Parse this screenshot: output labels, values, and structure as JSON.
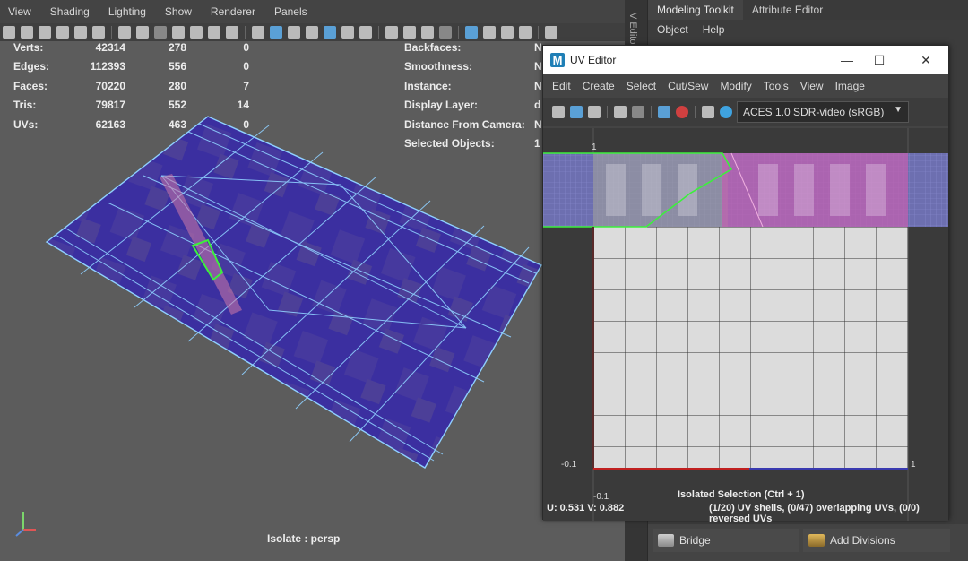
{
  "viewport": {
    "menu": [
      "View",
      "Shading",
      "Lighting",
      "Show",
      "Renderer",
      "Panels"
    ],
    "stats_left": [
      {
        "label": "Verts:",
        "a": "42314",
        "b": "278",
        "c": "0"
      },
      {
        "label": "Edges:",
        "a": "112393",
        "b": "556",
        "c": "0"
      },
      {
        "label": "Faces:",
        "a": "70220",
        "b": "280",
        "c": "7"
      },
      {
        "label": "Tris:",
        "a": "79817",
        "b": "552",
        "c": "14"
      },
      {
        "label": "UVs:",
        "a": "62163",
        "b": "463",
        "c": "0"
      }
    ],
    "stats_right": [
      {
        "label": "Backfaces:",
        "value": "N"
      },
      {
        "label": "Smoothness:",
        "value": "N"
      },
      {
        "label": "Instance:",
        "value": "N"
      },
      {
        "label": "Display Layer:",
        "value": "d"
      },
      {
        "label": "Distance From Camera:",
        "value": "N"
      },
      {
        "label": "Selected Objects:",
        "value": "1"
      }
    ],
    "isolate_label": "Isolate : persp"
  },
  "dock": {
    "vtab_label": "V Editor",
    "tabs": [
      "Modeling Toolkit",
      "Attribute Editor"
    ],
    "menu": [
      "Object",
      "Help"
    ],
    "bridge_label": "Bridge",
    "add_divisions_label": "Add Divisions"
  },
  "uv_editor": {
    "logo": "M",
    "title": "UV Editor",
    "menu": [
      "Edit",
      "Create",
      "Select",
      "Cut/Sew",
      "Modify",
      "Tools",
      "View",
      "Image"
    ],
    "colorspace": "ACES 1.0 SDR-video (sRGB)",
    "axis_label_top": "1",
    "axis_label_left": "-0.1",
    "axis_label_right": "1",
    "axis_label_bottom": "-0.1",
    "coord_text": "U:  0.531 V:  0.882",
    "status_line1": "Isolated Selection (Ctrl + 1)",
    "status_line2": "(1/20) UV shells, (0/47) overlapping UVs, (0/0) reversed UVs"
  },
  "colors": {
    "plane": "#3c2e9e",
    "wire": "#8fd0ff",
    "selection": "#3cf03c",
    "uv_grid": "#dcdcdc",
    "texture_pink": "#c060b0"
  }
}
